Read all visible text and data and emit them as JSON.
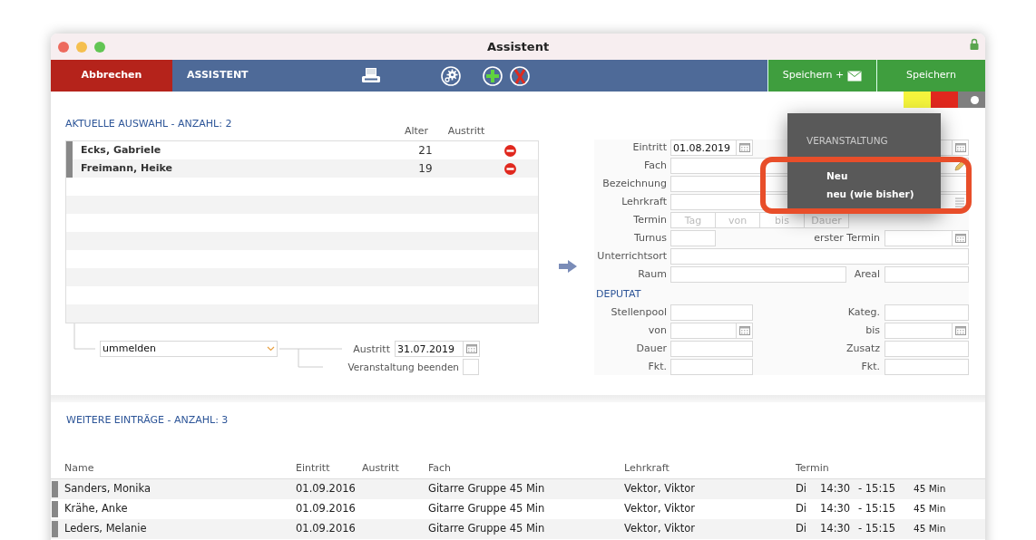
{
  "window": {
    "title": "Assistent"
  },
  "toolbar": {
    "cancel_button": "Abbrechen",
    "title": "ASSISTENT",
    "save_mail_button": "Speichern +",
    "save_button": "Speichern"
  },
  "status_strip": [
    {
      "color": "#f4f43c"
    },
    {
      "color": "#e0281e"
    },
    {
      "color": "#7f7f7f"
    }
  ],
  "selection": {
    "heading": "AKTUELLE AUSWAHL - ANZAHL: 2",
    "columns": [
      "Alter",
      "Austritt"
    ],
    "rows": [
      {
        "name": "Ecks, Gabriele",
        "age": "21"
      },
      {
        "name": "Freimann, Heike",
        "age": "19"
      }
    ]
  },
  "action": {
    "value": "ummelden",
    "exit_label": "Austritt",
    "exit_date": "31.07.2019",
    "end_label": "Veranstaltung beenden",
    "end_checked": false
  },
  "form": {
    "fields": [
      {
        "label": "Eintritt",
        "kind": "date",
        "value": "01.08.2019",
        "right": {
          "kind": "date"
        }
      },
      {
        "label": "Fach",
        "kind": "full-edit"
      },
      {
        "label": "Bezeichnung",
        "kind": "full"
      },
      {
        "label": "Lehrkraft",
        "kind": "full-list"
      },
      {
        "label": "Termin",
        "kind": "termin",
        "placeholders": [
          "Tag",
          "von",
          "bis",
          "Dauer"
        ]
      },
      {
        "label": "Turnus",
        "kind": "short",
        "right": {
          "label": "erster Termin",
          "kind": "date"
        }
      },
      {
        "label": "Unterrichtsort",
        "kind": "full"
      },
      {
        "label": "Raum",
        "kind": "wide",
        "right": {
          "label": "Areal",
          "kind": "text"
        }
      }
    ],
    "deputat_heading": "DEPUTAT",
    "deputat": [
      {
        "label": "Stellenpool",
        "kind": "text",
        "right": {
          "label": "Kateg.",
          "kind": "text"
        }
      },
      {
        "label": "von",
        "kind": "date",
        "right": {
          "label": "bis",
          "kind": "date"
        }
      },
      {
        "label": "Dauer",
        "kind": "text",
        "right": {
          "label": "Zusatz",
          "kind": "text"
        }
      },
      {
        "label": "Fkt.",
        "kind": "text",
        "right": {
          "label": "Fkt.",
          "kind": "text"
        }
      }
    ]
  },
  "popup": {
    "heading": "VERANSTALTUNG",
    "items": [
      {
        "label": "Neu"
      },
      {
        "label": "neu (wie bisher)"
      }
    ]
  },
  "entries": {
    "heading": "WEITERE EINTRÄGE - ANZAHL: 3",
    "columns": [
      "Name",
      "Eintritt",
      "Austritt",
      "Fach",
      "Lehrkraft",
      "Termin"
    ],
    "rows": [
      {
        "name": "Sanders, Monika",
        "entry": "01.09.2016",
        "subject": "Gitarre Gruppe 45 Min",
        "teacher": "Vektor, Viktor",
        "day": "Di",
        "from": "14:30",
        "to": "- 15:15",
        "duration": "45 Min"
      },
      {
        "name": "Krähe, Anke",
        "entry": "01.09.2016",
        "subject": "Gitarre Gruppe 45 Min",
        "teacher": "Vektor, Viktor",
        "day": "Di",
        "from": "14:30",
        "to": "- 15:15",
        "duration": "45 Min"
      },
      {
        "name": "Leders, Melanie",
        "entry": "01.09.2016",
        "subject": "Gitarre Gruppe 45 Min",
        "teacher": "Vektor, Viktor",
        "day": "Di",
        "from": "14:30",
        "to": "- 15:15",
        "duration": "45 Min"
      }
    ]
  }
}
